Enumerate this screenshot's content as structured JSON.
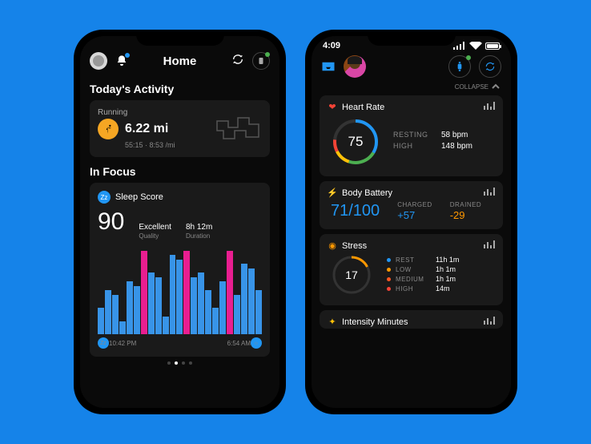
{
  "phoneA": {
    "title": "Home",
    "activity": {
      "section_title": "Today's Activity",
      "type_label": "Running",
      "distance": "6.22 mi",
      "subline": "55:15 · 8:53 /mi"
    },
    "focus": {
      "section_title": "In Focus",
      "card_title": "Sleep Score",
      "score": "90",
      "quality_value": "Excellent",
      "quality_label": "Quality",
      "duration_value": "8h 12m",
      "duration_label": "Duration",
      "x_start": "10:42 PM",
      "x_end": "6:54 AM"
    }
  },
  "phoneB": {
    "time": "4:09",
    "collapse_label": "COLLAPSE",
    "heart_rate": {
      "title": "Heart Rate",
      "value": "75",
      "resting_label": "RESTING",
      "resting_value": "58 bpm",
      "high_label": "HIGH",
      "high_value": "148 bpm"
    },
    "body_battery": {
      "title": "Body Battery",
      "value": "71",
      "value_suffix": "/100",
      "charged_label": "CHARGED",
      "charged_value": "+57",
      "drained_label": "DRAINED",
      "drained_value": "-29"
    },
    "stress": {
      "title": "Stress",
      "value": "17",
      "legend": [
        {
          "color": "#2196f3",
          "label": "REST",
          "value": "11h 1m"
        },
        {
          "color": "#ff9800",
          "label": "LOW",
          "value": "1h 1m"
        },
        {
          "color": "#ff5722",
          "label": "MEDIUM",
          "value": "1h 1m"
        },
        {
          "color": "#f44336",
          "label": "HIGH",
          "value": "14m"
        }
      ]
    },
    "intensity": {
      "title": "Intensity Minutes"
    }
  },
  "chart_data": [
    {
      "type": "bar",
      "title": "Sleep Score stage timeline",
      "categories_note": "time bins between 10:42 PM and 6:54 AM",
      "series": [
        {
          "name": "light/deep (blue)",
          "color": "#3894e8",
          "values": [
            30,
            50,
            45,
            15,
            60,
            55,
            35,
            70,
            65,
            20,
            90,
            85,
            30,
            65,
            70,
            50,
            30,
            60,
            55,
            45,
            80,
            75,
            50
          ]
        },
        {
          "name": "REM/awake (pink)",
          "color": "#e91e90",
          "values": [
            0,
            0,
            0,
            0,
            0,
            0,
            95,
            0,
            0,
            0,
            0,
            0,
            95,
            0,
            0,
            0,
            0,
            0,
            95,
            0,
            0,
            0,
            0
          ]
        }
      ],
      "xlabel": "",
      "ylabel": "",
      "x_start": "10:42 PM",
      "x_end": "6:54 AM"
    }
  ]
}
